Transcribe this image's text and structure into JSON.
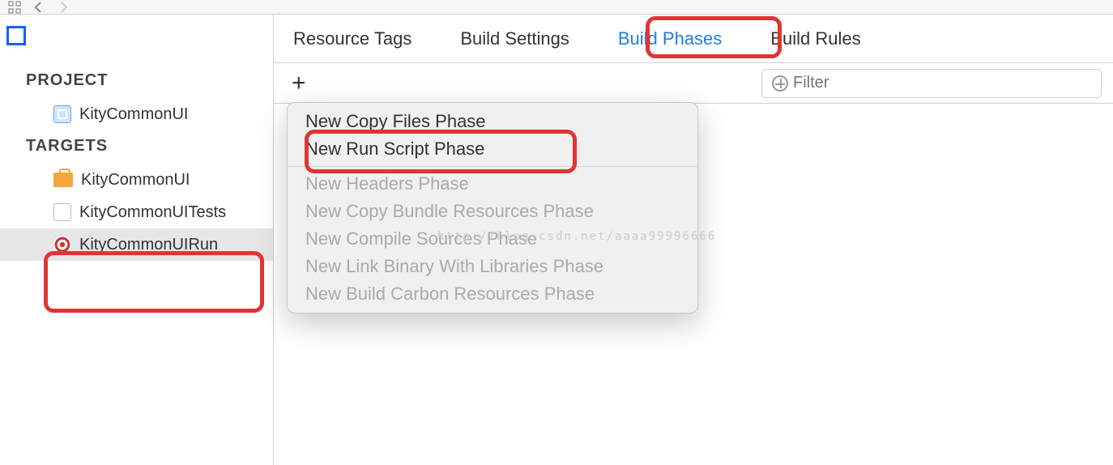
{
  "sidebar": {
    "project_label": "PROJECT",
    "targets_label": "TARGETS",
    "project_name": "KityCommonUI",
    "targets": [
      {
        "label": "KityCommonUI"
      },
      {
        "label": "KityCommonUITests"
      },
      {
        "label": "KityCommonUIRun"
      }
    ]
  },
  "tabs": {
    "resource_tags": "Resource Tags",
    "build_settings": "Build Settings",
    "build_phases": "Build Phases",
    "build_rules": "Build Rules"
  },
  "filter": {
    "placeholder": "Filter"
  },
  "menu": {
    "copy_files": "New Copy Files Phase",
    "run_script": "New Run Script Phase",
    "headers": "New Headers Phase",
    "copy_bundle": "New Copy Bundle Resources Phase",
    "compile_sources": "New Compile Sources Phase",
    "link_binary": "New Link Binary With Libraries Phase",
    "carbon": "New Build Carbon Resources Phase"
  },
  "watermark": "http://blog.csdn.net/aaaa99996666"
}
